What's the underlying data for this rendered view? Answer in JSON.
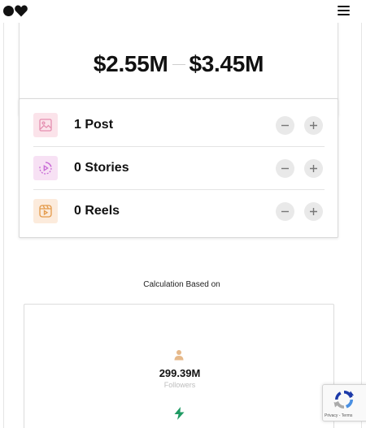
{
  "header": {
    "logo_icon": "dot-heart-logo",
    "menu_icon": "hamburger-menu-icon"
  },
  "estimate": {
    "low": "$2.55M",
    "high": "$3.45M"
  },
  "counters": [
    {
      "label": "1 Post",
      "icon": "image-icon",
      "icon_color": "#e58fb0",
      "icon_bg": "#fbe3ea"
    },
    {
      "label": "0 Stories",
      "icon": "story-play-icon",
      "icon_color": "#c86ad6",
      "icon_bg": "#f7e1f4"
    },
    {
      "label": "0 Reels",
      "icon": "reels-icon",
      "icon_color": "#e49a4a",
      "icon_bg": "#fcebdc"
    }
  ],
  "calculation": {
    "heading": "Calculation Based on",
    "followers_value": "299.39M",
    "followers_label": "Followers",
    "person_icon_color": "#e6b98a",
    "bolt_icon_color": "#1f9a63"
  },
  "recaptcha": {
    "footer": "Privacy - Terms"
  }
}
